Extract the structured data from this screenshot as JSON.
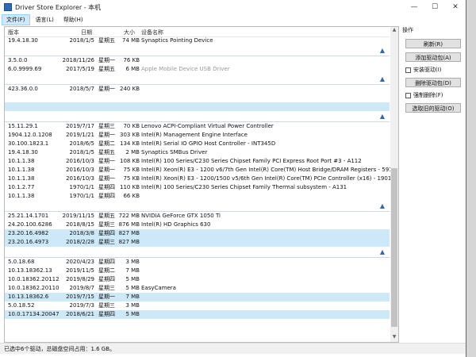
{
  "window": {
    "title": "Driver Store Explorer - 本机",
    "minimize": "—",
    "maximize": "☐",
    "close": "✕"
  },
  "menu": [
    {
      "label": "文件(F)"
    },
    {
      "label": "语言(L)"
    },
    {
      "label": "帮助(H)"
    }
  ],
  "columns": {
    "version": "版本",
    "date": "日期",
    "size": "大小",
    "name": "设备名称"
  },
  "rows": [
    {
      "type": "row",
      "version": "19.4.18.30",
      "date": "2018/1/5",
      "day": "星期五",
      "size": "74 MB",
      "name": "Synaptics Pointing Device"
    },
    {
      "type": "divider",
      "caret": "▲"
    },
    {
      "type": "row",
      "version": "3.5.0.0",
      "date": "2018/11/26",
      "day": "星期一",
      "size": "76 KB",
      "name": ""
    },
    {
      "type": "row",
      "version": "6.0.9999.69",
      "date": "2017/5/19",
      "day": "星期五",
      "size": "6 MB",
      "name": "Apple Mobile Device USB Driver",
      "grey": true
    },
    {
      "type": "divider",
      "caret": "▲"
    },
    {
      "type": "row",
      "version": "423.36.0.0",
      "date": "2018/5/7",
      "day": "星期一",
      "size": "240 KB",
      "name": ""
    },
    {
      "type": "blank"
    },
    {
      "type": "row",
      "sel": true,
      "version": "",
      "date": "",
      "day": "",
      "size": "",
      "name": ""
    },
    {
      "type": "divider",
      "caret": "▲"
    },
    {
      "type": "row",
      "version": "15.11.29.1",
      "date": "2019/7/17",
      "day": "星期三",
      "size": "70 KB",
      "name": "Lenovo ACPI-Compliant Virtual Power Controller"
    },
    {
      "type": "row",
      "version": "1904.12.0.1208",
      "date": "2019/1/21",
      "day": "星期一",
      "size": "303 KB",
      "name": "Intel(R) Management Engine Interface"
    },
    {
      "type": "row",
      "version": "30.100.1823.1",
      "date": "2018/6/5",
      "day": "星期二",
      "size": "134 KB",
      "name": "Intel(R) Serial IO GPIO Host Controller - INT345D"
    },
    {
      "type": "row",
      "version": "19.4.18.30",
      "date": "2018/1/5",
      "day": "星期五",
      "size": "2 MB",
      "name": "Synaptics SMBus Driver"
    },
    {
      "type": "row",
      "version": "10.1.1.38",
      "date": "2016/10/3",
      "day": "星期一",
      "size": "108 KB",
      "name": "Intel(R) 100 Series/C230 Series Chipset Family PCI Express Root Port #3 - A112"
    },
    {
      "type": "row",
      "version": "10.1.1.38",
      "date": "2016/10/3",
      "day": "星期一",
      "size": "75 KB",
      "name": "Intel(R) Xeon(R) E3 - 1200 v6/7th Gen Intel(R) Core(TM) Host Bridge/DRAM Registers - 5910"
    },
    {
      "type": "row",
      "version": "10.1.1.38",
      "date": "2016/10/3",
      "day": "星期一",
      "size": "75 KB",
      "name": "Intel(R) Xeon(R) E3 - 1200/1500 v5/6th Gen Intel(R) Core(TM) PCIe Controller (x16) - 1901"
    },
    {
      "type": "row",
      "version": "10.1.2.77",
      "date": "1970/1/1",
      "day": "星期四",
      "size": "110 KB",
      "name": "Intel(R) 100 Series/C230 Series Chipset Family Thermal subsystem - A131"
    },
    {
      "type": "row",
      "version": "10.1.1.38",
      "date": "1970/1/1",
      "day": "星期四",
      "size": "66 KB",
      "name": ""
    },
    {
      "type": "divider",
      "caret": "▲"
    },
    {
      "type": "row",
      "version": "25.21.14.1701",
      "date": "2019/11/15",
      "day": "星期五",
      "size": "722 MB",
      "name": "NVIDIA GeForce GTX 1050 Ti"
    },
    {
      "type": "row",
      "version": "24.20.100.6286",
      "date": "2018/8/15",
      "day": "星期三",
      "size": "876 MB",
      "name": "Intel(R) HD Graphics 630"
    },
    {
      "type": "row",
      "sel": true,
      "version": "23.20.16.4982",
      "date": "2018/3/8",
      "day": "星期四",
      "size": "827 MB",
      "name": ""
    },
    {
      "type": "row",
      "sel": true,
      "version": "23.20.16.4973",
      "date": "2018/2/28",
      "day": "星期三",
      "size": "827 MB",
      "name": ""
    },
    {
      "type": "divider",
      "caret": "▲"
    },
    {
      "type": "row",
      "version": "5.0.18.68",
      "date": "2020/4/23",
      "day": "星期四",
      "size": "3 MB",
      "name": ""
    },
    {
      "type": "row",
      "version": "10.13.18362.13",
      "date": "2019/11/5",
      "day": "星期二",
      "size": "7 MB",
      "name": ""
    },
    {
      "type": "row",
      "version": "10.0.18362.20112",
      "date": "2019/8/29",
      "day": "星期四",
      "size": "5 MB",
      "name": ""
    },
    {
      "type": "row",
      "version": "10.0.18362.20110",
      "date": "2019/8/7",
      "day": "星期三",
      "size": "5 MB",
      "name": "EasyCamera"
    },
    {
      "type": "row",
      "sel": true,
      "version": "10.13.18362.6",
      "date": "2019/7/15",
      "day": "星期一",
      "size": "7 MB",
      "name": ""
    },
    {
      "type": "row",
      "version": "5.0.18.52",
      "date": "2019/7/3",
      "day": "星期三",
      "size": "3 MB",
      "name": ""
    },
    {
      "type": "row",
      "sel": true,
      "version": "10.0.17134.20047",
      "date": "2018/6/21",
      "day": "星期四",
      "size": "5 MB",
      "name": ""
    }
  ],
  "ops": {
    "title": "操作",
    "refresh": "刷新(R)",
    "add": "添加驱动包(A)",
    "install_label": "安装驱动(I)",
    "delete": "删除驱动包(D)",
    "force_label": "强制删除(F)",
    "select_old": "选取旧的驱动(O)"
  },
  "status": "已选中6个驱动，总磁盘空间占用：1.6 GB。",
  "scroll": {
    "up": "▲",
    "down": "▼"
  }
}
